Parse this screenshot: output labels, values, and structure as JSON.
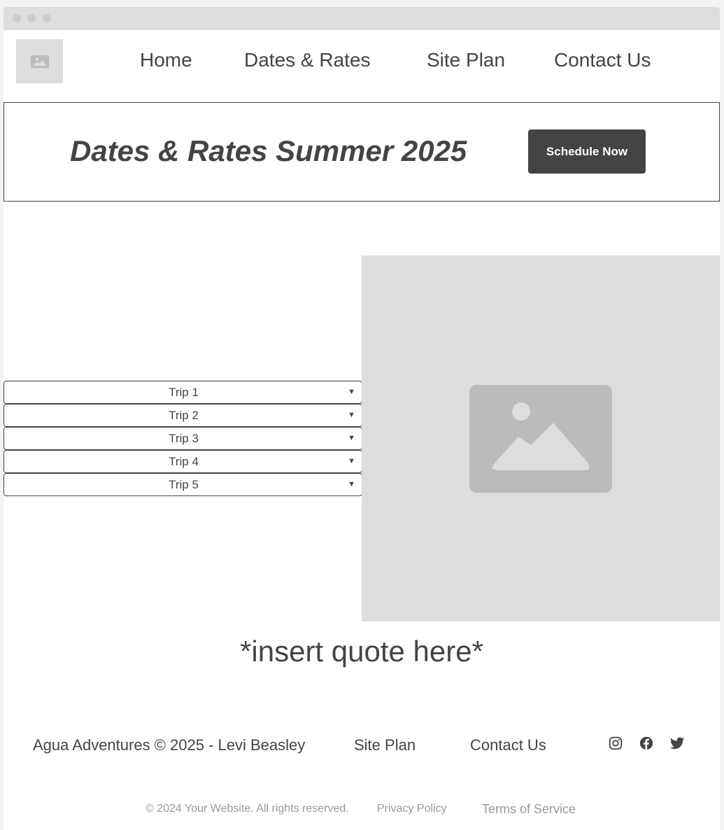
{
  "nav": {
    "items": [
      {
        "label": "Home"
      },
      {
        "label": "Dates & Rates"
      },
      {
        "label": "Site Plan"
      },
      {
        "label": "Contact Us"
      }
    ]
  },
  "hero": {
    "title": "Dates & Rates Summer 2025",
    "cta_label": "Schedule Now"
  },
  "trips": [
    {
      "label": "Trip 1"
    },
    {
      "label": "Trip 2"
    },
    {
      "label": "Trip 3"
    },
    {
      "label": "Trip 4"
    },
    {
      "label": "Trip 5"
    }
  ],
  "quote": "*insert quote here*",
  "footer": {
    "credit": "Agua Adventures © 2025 - Levi Beasley",
    "links": [
      {
        "label": "Site Plan"
      },
      {
        "label": "Contact Us"
      }
    ],
    "social_icons": [
      "instagram-icon",
      "facebook-icon",
      "twitter-icon"
    ]
  },
  "legal": {
    "copyright": "© 2024 Your Website. All rights reserved.",
    "privacy": "Privacy Policy",
    "terms": "Terms of Service"
  },
  "colors": {
    "dark": "#444444",
    "placeholder": "#dddddd",
    "placeholder_icon": "#bbbbbb",
    "muted_text": "#999999"
  }
}
